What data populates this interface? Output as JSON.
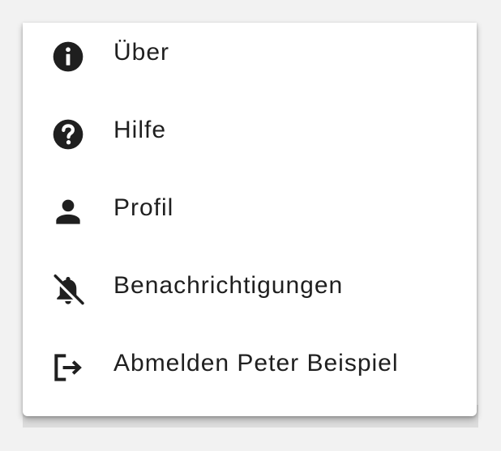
{
  "menu": {
    "items": [
      {
        "label": "Über",
        "icon": "info-icon"
      },
      {
        "label": "Hilfe",
        "icon": "help-icon"
      },
      {
        "label": "Profil",
        "icon": "person-icon"
      },
      {
        "label": "Benachrichtigungen",
        "icon": "notifications-off-icon"
      },
      {
        "label": "Abmelden Peter Beispiel",
        "icon": "logout-icon"
      }
    ]
  },
  "colors": {
    "background": "#f2f2f2",
    "menu_surface": "#ffffff",
    "text": "#1f1f1f",
    "icon": "#1f1f1f"
  }
}
